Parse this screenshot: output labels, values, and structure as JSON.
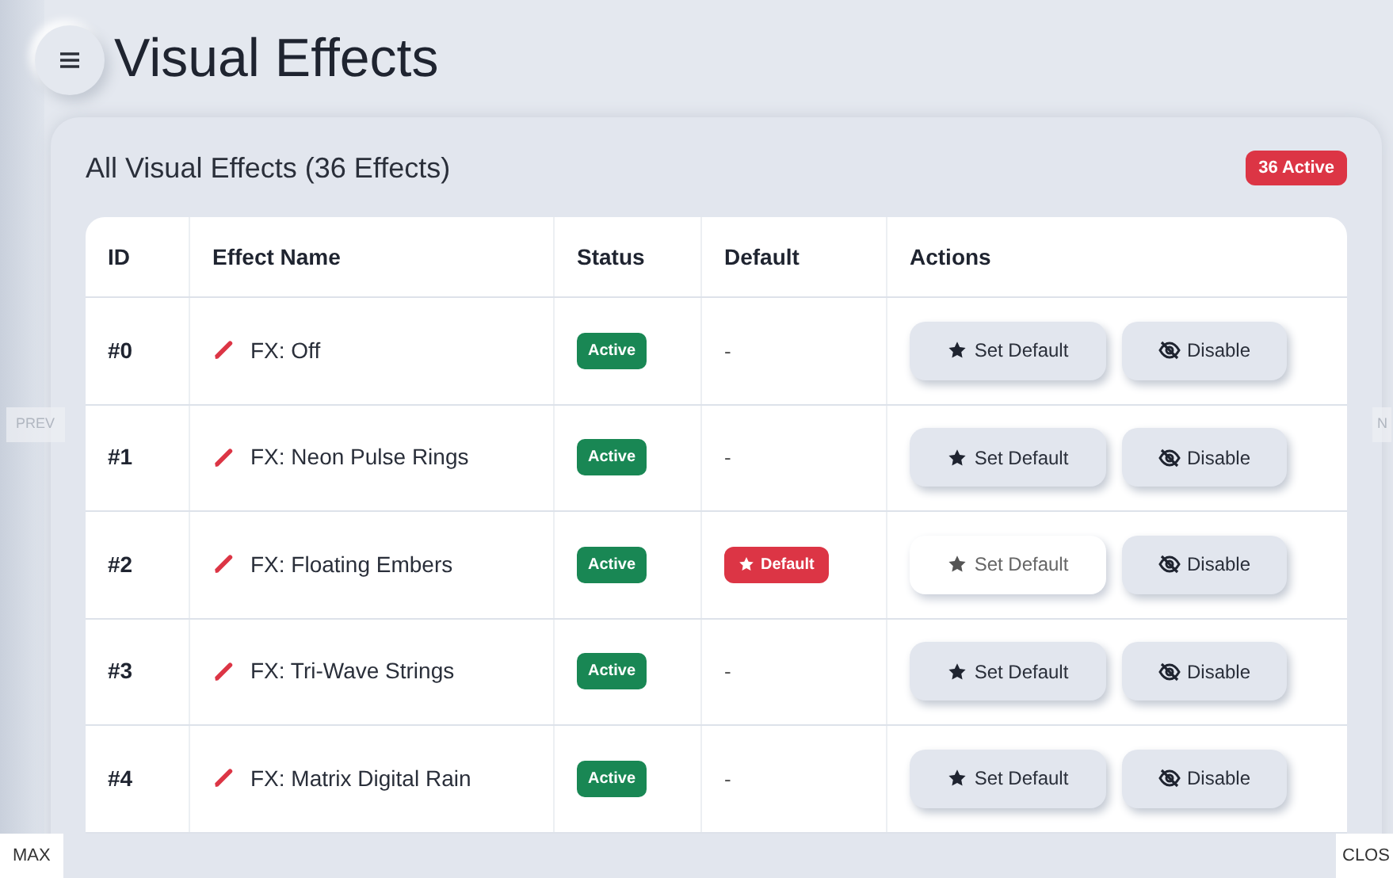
{
  "page": {
    "title": "Visual Effects"
  },
  "card": {
    "title": "All Visual Effects (36 Effects)",
    "badge": "36 Active"
  },
  "table": {
    "columns": [
      "ID",
      "Effect Name",
      "Status",
      "Default",
      "Actions"
    ],
    "rows": [
      {
        "id": "#0",
        "name": "FX: Off",
        "status": "Active",
        "default": "-",
        "is_default": false,
        "actions": [
          "Set Default",
          "Disable"
        ]
      },
      {
        "id": "#1",
        "name": "FX: Neon Pulse Rings",
        "status": "Active",
        "default": "-",
        "is_default": false,
        "actions": [
          "Set Default",
          "Disable"
        ]
      },
      {
        "id": "#2",
        "name": "FX: Floating Embers",
        "status": "Active",
        "default": "Default",
        "is_default": true,
        "actions": [
          "Set Default",
          "Disable"
        ]
      },
      {
        "id": "#3",
        "name": "FX: Tri-Wave Strings",
        "status": "Active",
        "default": "-",
        "is_default": false,
        "actions": [
          "Set Default",
          "Disable"
        ]
      },
      {
        "id": "#4",
        "name": "FX: Matrix Digital Rain",
        "status": "Active",
        "default": "-",
        "is_default": false,
        "actions": [
          "Set Default",
          "Disable"
        ]
      }
    ]
  },
  "overlay": {
    "prev": "PREV",
    "next": "N",
    "max": "MAX",
    "close": "CLOS"
  }
}
